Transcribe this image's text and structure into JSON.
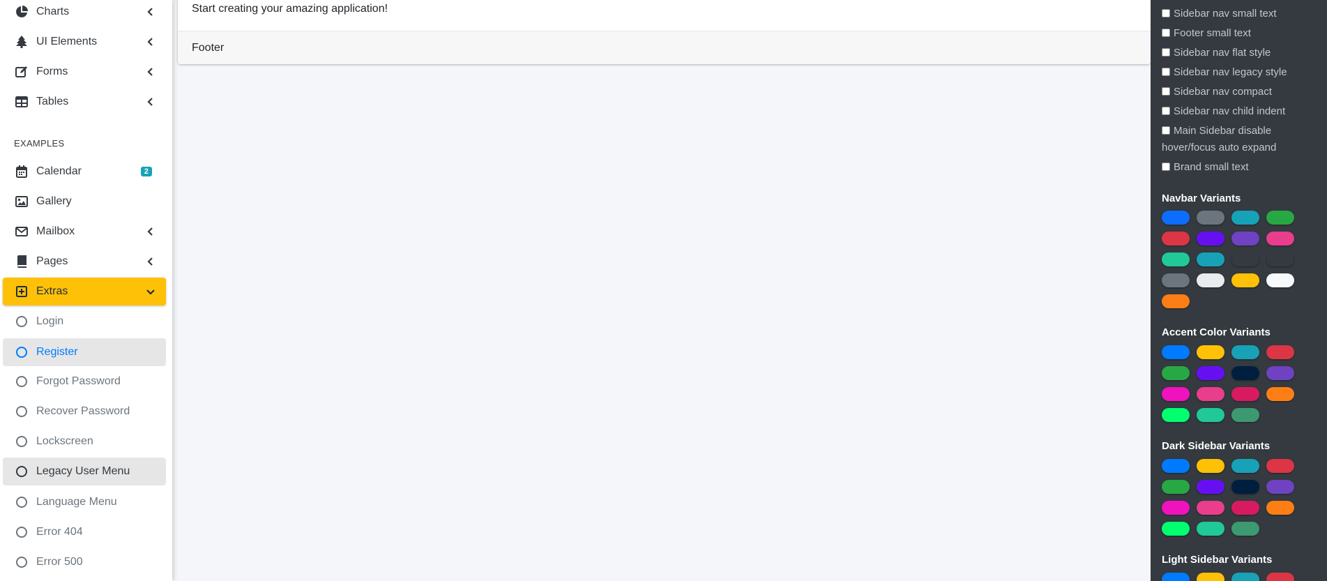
{
  "sidebar": {
    "items_top": [
      {
        "label": "Charts",
        "icon": "chart-pie-icon"
      },
      {
        "label": "UI Elements",
        "icon": "tree-icon"
      },
      {
        "label": "Forms",
        "icon": "edit-icon"
      },
      {
        "label": "Tables",
        "icon": "table-icon"
      }
    ],
    "header": "EXAMPLES",
    "calendar": {
      "label": "Calendar",
      "badge": "2"
    },
    "gallery": {
      "label": "Gallery"
    },
    "mailbox": {
      "label": "Mailbox"
    },
    "pages": {
      "label": "Pages"
    },
    "extras": {
      "label": "Extras"
    },
    "extras_children": [
      {
        "label": "Login"
      },
      {
        "label": "Register"
      },
      {
        "label": "Forgot Password"
      },
      {
        "label": "Recover Password"
      },
      {
        "label": "Lockscreen"
      },
      {
        "label": "Legacy User Menu"
      },
      {
        "label": "Language Menu"
      },
      {
        "label": "Error 404"
      },
      {
        "label": "Error 500"
      }
    ]
  },
  "content": {
    "body_text": "Start creating your amazing application!",
    "footer_text": "Footer"
  },
  "control": {
    "checkboxes": [
      "Sidebar nav small text",
      "Footer small text",
      "Sidebar nav flat style",
      "Sidebar nav legacy style",
      "Sidebar nav compact",
      "Sidebar nav child indent",
      "Main Sidebar disable hover/focus auto expand",
      "Brand small text"
    ],
    "navbar_title": "Navbar Variants",
    "navbar_colors": [
      "#0d6efd",
      "#6c757d",
      "#17a2b8",
      "#28a745",
      "#dc3545",
      "#6610f2",
      "#6f42c1",
      "#e83e8c",
      "#20c997",
      "#17a2b8",
      "#343a40",
      "#343a40",
      "#6c757d",
      "#e9ecef",
      "#ffc107",
      "#f8f9fa",
      "#fd7e14"
    ],
    "accent_title": "Accent Color Variants",
    "accent_colors": [
      "#007bff",
      "#ffc107",
      "#17a2b8",
      "#dc3545",
      "#28a745",
      "#6610f2",
      "#001f3f",
      "#6f42c1",
      "#f012be",
      "#e83e8c",
      "#d81b60",
      "#fd7e14",
      "#01ff70",
      "#20c997",
      "#3d9970"
    ],
    "dark_title": "Dark Sidebar Variants",
    "dark_colors": [
      "#007bff",
      "#ffc107",
      "#17a2b8",
      "#dc3545",
      "#28a745",
      "#6610f2",
      "#001f3f",
      "#6f42c1",
      "#f012be",
      "#e83e8c",
      "#d81b60",
      "#fd7e14",
      "#01ff70",
      "#20c997",
      "#3d9970"
    ],
    "light_title": "Light Sidebar Variants",
    "light_colors": [
      "#007bff",
      "#ffc107",
      "#17a2b8",
      "#dc3545"
    ]
  },
  "colors": {
    "active_yellow": "#ffc107",
    "link_blue": "#007bff",
    "badge_teal": "#17a2b8",
    "control_bg": "#343a40"
  }
}
